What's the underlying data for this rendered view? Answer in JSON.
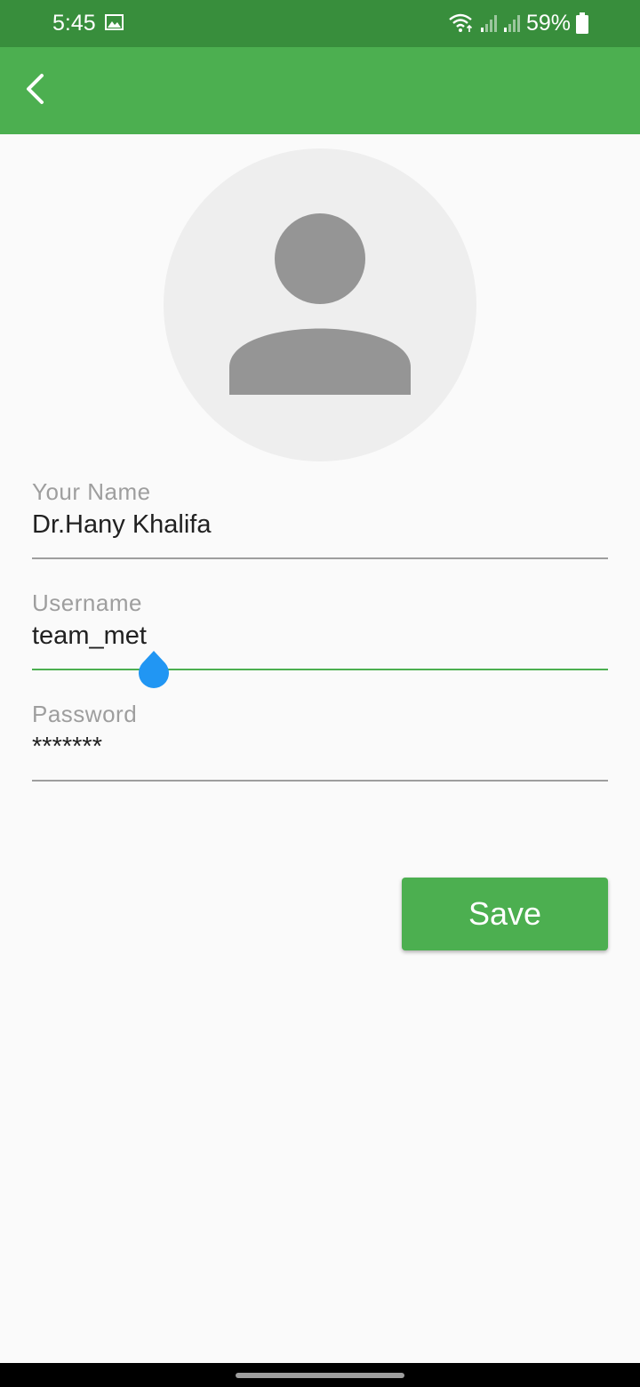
{
  "status_bar": {
    "time": "5:45",
    "battery": "59%",
    "icons": [
      "image-icon",
      "wifi-icon",
      "signal-icon",
      "signal-icon",
      "battery-icon"
    ]
  },
  "app_bar": {
    "back_icon": "back-arrow-icon",
    "color": "#4caf50"
  },
  "profile": {
    "avatar_icon": "person-placeholder-icon"
  },
  "form": {
    "name_label": "Your Name",
    "name_value": "Dr.Hany Khalifa",
    "username_label": "Username",
    "username_value": "team_met",
    "password_label": "Password",
    "password_value": "*******"
  },
  "actions": {
    "save_label": "Save"
  },
  "colors": {
    "primary": "#4caf50",
    "primary_dark": "#388e3c",
    "cursor": "#2196f3"
  }
}
